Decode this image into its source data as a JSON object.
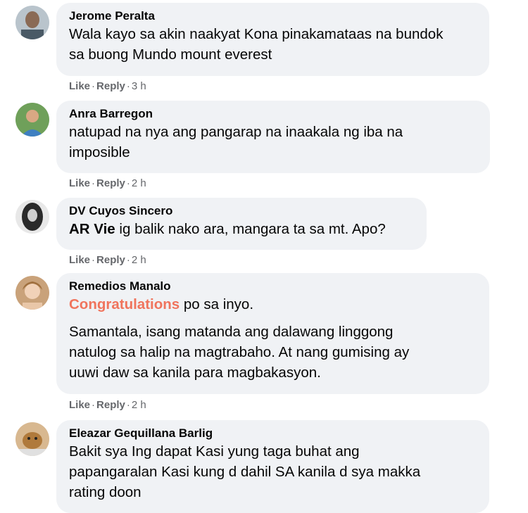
{
  "comments": [
    {
      "author": "Jerome Peralta",
      "avatar_icon": "user-avatar-icon",
      "lines": [
        "Wala kayo sa akin naakyat Kona pinakamataas na bundok",
        "sa buong Mundo mount everest"
      ],
      "like": "Like",
      "reply": "Reply",
      "time": "3 h"
    },
    {
      "author": "Anra Barregon",
      "avatar_icon": "user-avatar-icon",
      "lines": [
        "natupad na nya ang pangarap na inaakala ng iba na",
        "imposible"
      ],
      "like": "Like",
      "reply": "Reply",
      "time": "2 h"
    },
    {
      "author": "DV Cuyos Sincero",
      "avatar_icon": "user-avatar-icon",
      "mention": "AR Vie",
      "text_after_mention": " ig balik nako ara, mangara ta sa mt. Apo?",
      "like": "Like",
      "reply": "Reply",
      "time": "2 h"
    },
    {
      "author": "Remedios Manalo",
      "avatar_icon": "user-avatar-icon",
      "highlight": "Congratulations",
      "text_after_highlight": " po sa inyo.",
      "lines": [
        "Samantala, isang matanda ang dalawang linggong",
        "natulog sa halip na magtrabaho. At nang gumising ay",
        "uuwi daw sa kanila para magbakasyon."
      ],
      "like": "Like",
      "reply": "Reply",
      "time": "2 h"
    },
    {
      "author": "Eleazar Gequillana Barlig",
      "avatar_icon": "user-avatar-icon",
      "lines": [
        "Bakit sya Ing dapat Kasi yung taga buhat ang",
        "papangaralan Kasi kung d dahil SA kanila d sya makka",
        "rating doon"
      ]
    }
  ],
  "colors": {
    "bubble_bg": "#f0f2f5",
    "meta_text": "#65676b",
    "highlight": "#f0745d",
    "text": "#050505"
  }
}
